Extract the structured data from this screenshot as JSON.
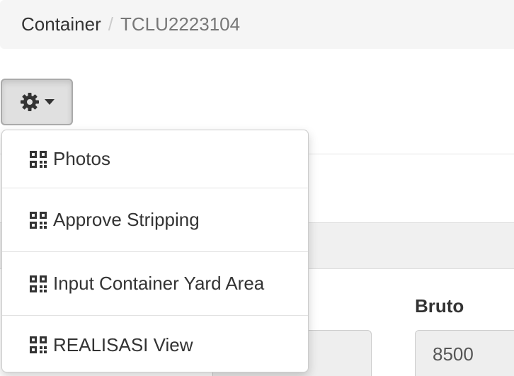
{
  "breadcrumb": {
    "parent": "Container",
    "separator": "/",
    "current": "TCLU2223104"
  },
  "toolbar": {
    "settings_icon": "gear-icon",
    "caret_icon": "caret-down-icon"
  },
  "menu": {
    "icon": "qrcode-icon",
    "items": [
      {
        "label": "Photos"
      },
      {
        "label": "Approve Stripping"
      },
      {
        "label": "Input Container Yard Area"
      },
      {
        "label": "REALISASI View"
      }
    ]
  },
  "form": {
    "bruto_label": "Bruto",
    "bruto_value": "8500"
  }
}
